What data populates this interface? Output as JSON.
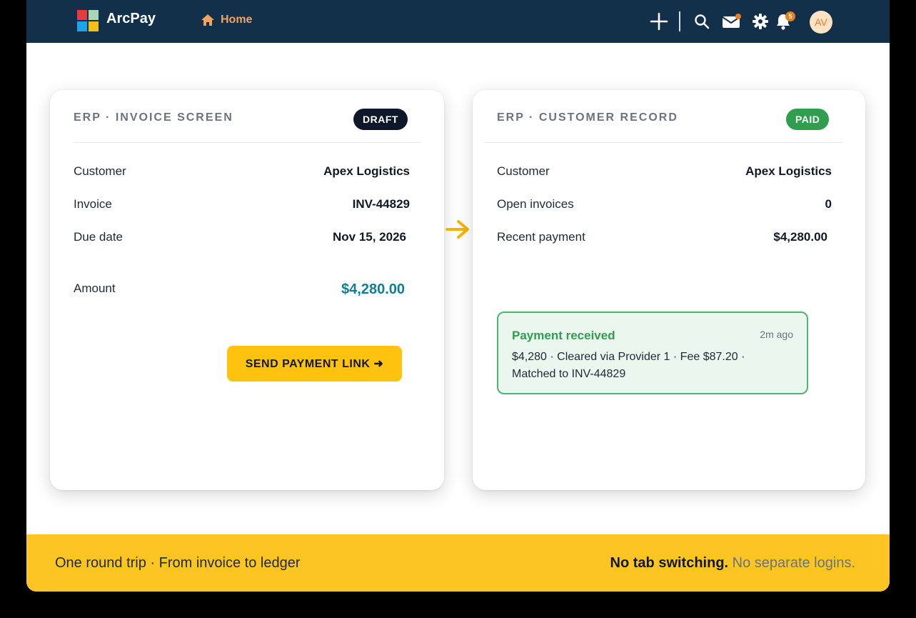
{
  "app": {
    "brand": "ArcPay",
    "nav": {
      "home_label": "Home"
    },
    "topbar_icons": [
      "plus-icon",
      "search-icon",
      "mail-icon",
      "gear-icon",
      "bell-icon"
    ],
    "notifications_count": "5",
    "avatar_initials": "AV",
    "colors": {
      "topbar": "#12304a",
      "accent_yellow": "#ffc20e",
      "success_green": "#2f9e4f",
      "amount_teal": "#0f7f96",
      "logo_red": "#e33d3d",
      "logo_mint": "#a7d7b8",
      "logo_blue": "#1ea4e8",
      "logo_yellow": "#f2c019"
    }
  },
  "invoice_card": {
    "title": "ERP · INVOICE SCREEN",
    "status": "DRAFT",
    "rows": [
      {
        "label": "Customer",
        "value": "Apex Logistics"
      },
      {
        "label": "Invoice",
        "value": "INV-44829"
      },
      {
        "label": "Due date",
        "value": "Nov 15, 2026"
      }
    ],
    "amount_label": "Amount",
    "amount_value": "$4,280.00",
    "button_label": "SEND PAYMENT LINK ➜"
  },
  "customer_card": {
    "title": "ERP · CUSTOMER RECORD",
    "status": "PAID",
    "rows": [
      {
        "label": "Customer",
        "value": "Apex Logistics"
      },
      {
        "label": "Open invoices",
        "value": "0"
      },
      {
        "label": "Recent payment",
        "value": "$4,280.00"
      }
    ],
    "notification": {
      "title": "Payment received",
      "time": "2m ago",
      "text": "$4,280 · Cleared via Provider 1 · Fee $87.20 · Matched to INV-44829"
    }
  },
  "footer": {
    "left_text": "One round trip · From invoice to ledger",
    "right_strong": "No tab switching.",
    "right_muted": "No separate logins."
  }
}
